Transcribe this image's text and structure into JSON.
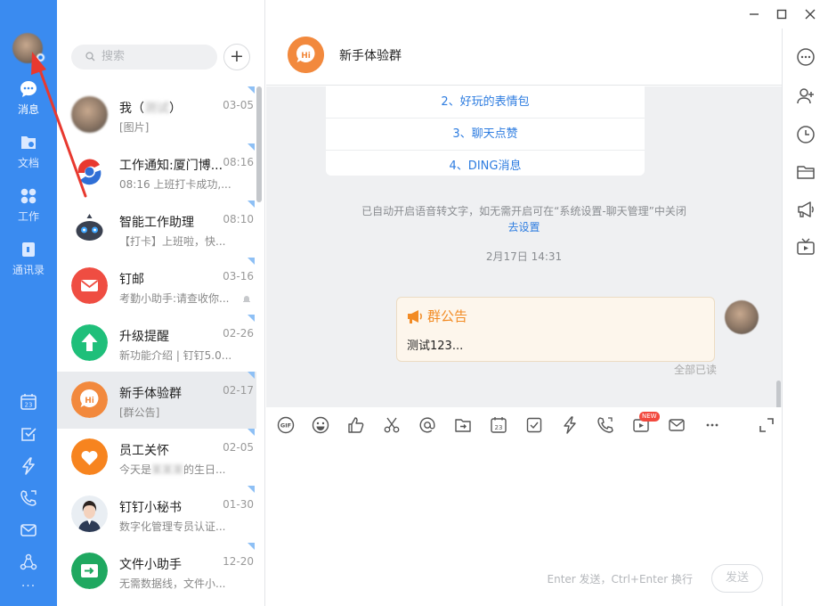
{
  "nav": {
    "items": [
      {
        "label": "消息",
        "icon": "chat-bubble-icon"
      },
      {
        "label": "文档",
        "icon": "folder-doc-icon"
      },
      {
        "label": "工作",
        "icon": "grid-apps-icon"
      },
      {
        "label": "通讯录",
        "icon": "contacts-icon"
      }
    ],
    "bottom_icons": [
      "calendar-icon",
      "todo-check-icon",
      "lightning-icon",
      "phone-icon",
      "mail-icon",
      "org-icon",
      "more-dots-icon"
    ],
    "calendar_day": "23",
    "more": "···"
  },
  "list": {
    "search_placeholder": "搜索",
    "add_label": "+",
    "conversations": [
      {
        "name": "我（",
        "name_blur": "测试",
        "name_end": "）",
        "time": "03-05",
        "preview": "[图片]"
      },
      {
        "name": "工作通知:厦门博...",
        "time": "08:16",
        "preview": "08:16 上班打卡成功,..."
      },
      {
        "name": "智能工作助理",
        "time": "08:10",
        "preview": "【打卡】上班啦，快..."
      },
      {
        "name": "钉邮",
        "time": "03-16",
        "preview": "考勤小助手:请查收你..."
      },
      {
        "name": "升级提醒",
        "time": "02-26",
        "preview": "新功能介绍 | 钉钉5.0..."
      },
      {
        "name": "新手体验群",
        "time": "02-17",
        "preview": "[群公告]"
      },
      {
        "name": "员工关怀",
        "time": "02-05",
        "preview": "今天是",
        "preview_blur": "某某某",
        "preview_end": "的生日..."
      },
      {
        "name": "钉钉小秘书",
        "time": "01-30",
        "preview": "数字化管理专员认证..."
      },
      {
        "name": "文件小助手",
        "time": "12-20",
        "preview": "无需数据线，文件小..."
      }
    ]
  },
  "chat": {
    "title": "新手体验群",
    "group_avatar_text": "Hi",
    "menu_items": [
      "2、好玩的表情包",
      "3、聊天点赞",
      "4、DING消息"
    ],
    "system_note": "已自动开启语音转文字，如无需开启可在“系统设置-聊天管理”中关闭",
    "system_link": "去设置",
    "date": "2月17日 14:31",
    "notice": {
      "title": "群公告",
      "body": "测试123..."
    },
    "read_status": "全部已读",
    "toolbar": {
      "gif": "GIF",
      "calendar_day": "23",
      "new_badge": "NEW"
    },
    "input_hint": "Enter 发送，Ctrl+Enter 换行",
    "send_label": "发送"
  },
  "colors": {
    "nav_blue": "#3a8bf0",
    "link_blue": "#2d7ce0",
    "notice_orange": "#f28b24",
    "selected_row": "#e9ebee"
  }
}
